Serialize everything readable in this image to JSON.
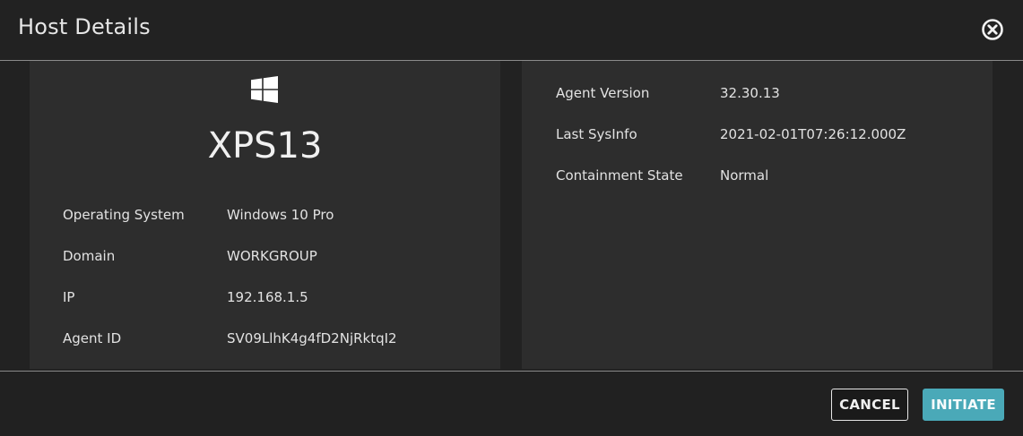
{
  "dialog": {
    "title": "Host Details",
    "close_icon": "close-circle-icon"
  },
  "host": {
    "os_icon": "windows-logo-icon",
    "name": "XPS13",
    "details": [
      {
        "label": "Operating System",
        "value": "Windows 10 Pro"
      },
      {
        "label": "Domain",
        "value": "WORKGROUP"
      },
      {
        "label": "IP",
        "value": "192.168.1.5"
      },
      {
        "label": "Agent ID",
        "value": "SV09LlhK4g4fD2NjRktqI2"
      }
    ]
  },
  "agent": {
    "details": [
      {
        "label": "Agent Version",
        "value": "32.30.13"
      },
      {
        "label": "Last SysInfo",
        "value": "2021-02-01T07:26:12.000Z"
      },
      {
        "label": "Containment State",
        "value": "Normal"
      }
    ]
  },
  "footer": {
    "cancel_label": "CANCEL",
    "initiate_label": "INITIATE"
  },
  "colors": {
    "background": "#222222",
    "panel": "#2d2d2d",
    "accent": "#4aa9b8",
    "text": "#e2e2e2"
  }
}
